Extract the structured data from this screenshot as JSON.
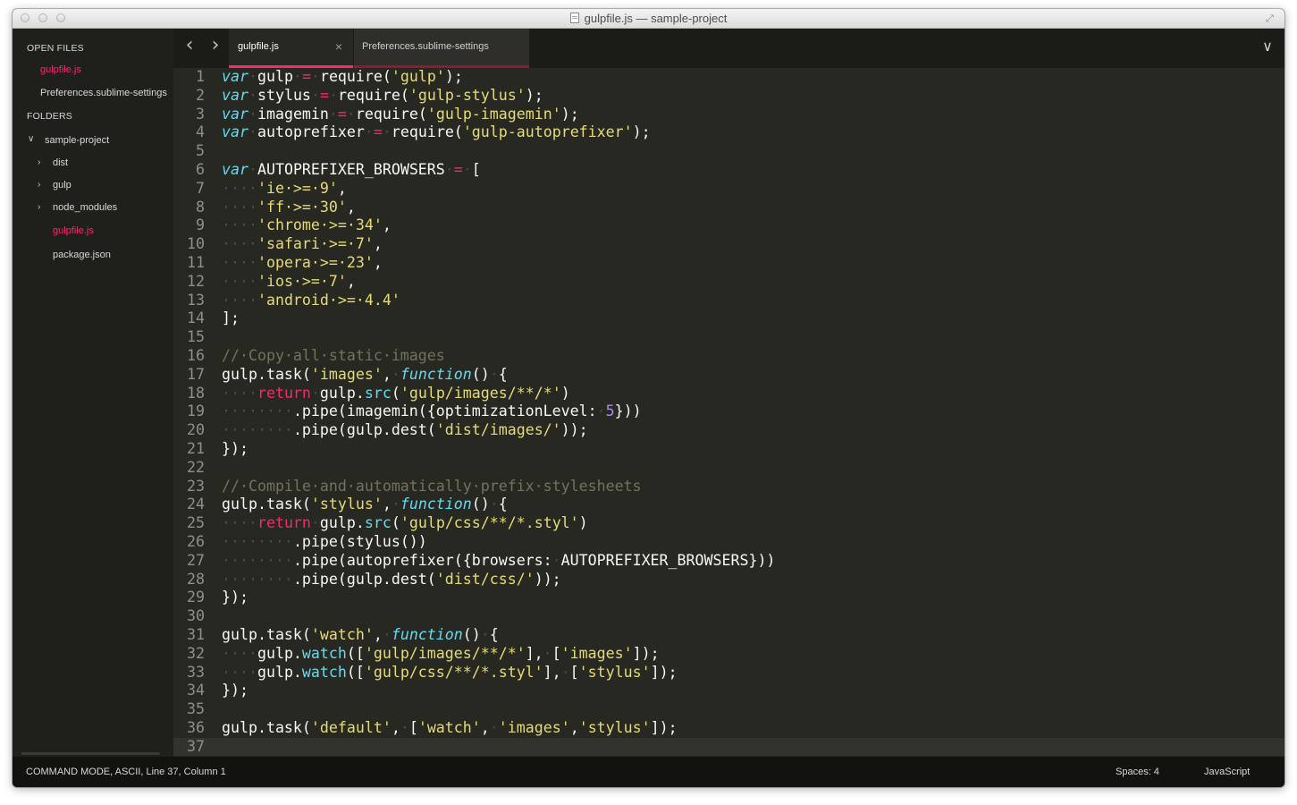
{
  "window": {
    "title": "gulpfile.js — sample-project"
  },
  "sidebar": {
    "open_files_heading": "OPEN FILES",
    "open_files": [
      {
        "label": "gulpfile.js",
        "active": true
      },
      {
        "label": "Preferences.sublime-settings",
        "active": false
      }
    ],
    "folders_heading": "FOLDERS",
    "project": "sample-project",
    "tree": [
      {
        "label": "dist",
        "type": "folder"
      },
      {
        "label": "gulp",
        "type": "folder"
      },
      {
        "label": "node_modules",
        "type": "folder"
      },
      {
        "label": "gulpfile.js",
        "type": "file",
        "active": true
      },
      {
        "label": "package.json",
        "type": "file"
      }
    ]
  },
  "tabs": [
    {
      "label": "gulpfile.js",
      "active": true
    },
    {
      "label": "Preferences.sublime-settings",
      "active": false
    }
  ],
  "editor": {
    "lines": [
      [
        [
          "k-storage",
          "var"
        ],
        [
          "ws",
          "·"
        ],
        [
          "",
          "gulp"
        ],
        [
          "ws",
          "·"
        ],
        [
          "k-op",
          "="
        ],
        [
          "ws",
          "·"
        ],
        [
          "",
          "require("
        ],
        [
          "k-string",
          "'gulp'"
        ],
        [
          "",
          ");"
        ]
      ],
      [
        [
          "k-storage",
          "var"
        ],
        [
          "ws",
          "·"
        ],
        [
          "",
          "stylus"
        ],
        [
          "ws",
          "·"
        ],
        [
          "k-op",
          "="
        ],
        [
          "ws",
          "·"
        ],
        [
          "",
          "require("
        ],
        [
          "k-string",
          "'gulp-stylus'"
        ],
        [
          "",
          ");"
        ]
      ],
      [
        [
          "k-storage",
          "var"
        ],
        [
          "ws",
          "·"
        ],
        [
          "",
          "imagemin"
        ],
        [
          "ws",
          "·"
        ],
        [
          "k-op",
          "="
        ],
        [
          "ws",
          "·"
        ],
        [
          "",
          "require("
        ],
        [
          "k-string",
          "'gulp-imagemin'"
        ],
        [
          "",
          ");"
        ]
      ],
      [
        [
          "k-storage",
          "var"
        ],
        [
          "ws",
          "·"
        ],
        [
          "",
          "autoprefixer"
        ],
        [
          "ws",
          "·"
        ],
        [
          "k-op",
          "="
        ],
        [
          "ws",
          "·"
        ],
        [
          "",
          "require("
        ],
        [
          "k-string",
          "'gulp-autoprefixer'"
        ],
        [
          "",
          ");"
        ]
      ],
      [],
      [
        [
          "k-storage",
          "var"
        ],
        [
          "ws",
          "·"
        ],
        [
          "",
          "AUTOPREFIXER_BROWSERS"
        ],
        [
          "ws",
          "·"
        ],
        [
          "k-op",
          "="
        ],
        [
          "ws",
          "·"
        ],
        [
          "",
          "["
        ]
      ],
      [
        [
          "ws",
          "····"
        ],
        [
          "k-string",
          "'ie·>=·9'"
        ],
        [
          "",
          ","
        ]
      ],
      [
        [
          "ws",
          "····"
        ],
        [
          "k-string",
          "'ff·>=·30'"
        ],
        [
          "",
          ","
        ]
      ],
      [
        [
          "ws",
          "····"
        ],
        [
          "k-string",
          "'chrome·>=·34'"
        ],
        [
          "",
          ","
        ]
      ],
      [
        [
          "ws",
          "····"
        ],
        [
          "k-string",
          "'safari·>=·7'"
        ],
        [
          "",
          ","
        ]
      ],
      [
        [
          "ws",
          "····"
        ],
        [
          "k-string",
          "'opera·>=·23'"
        ],
        [
          "",
          ","
        ]
      ],
      [
        [
          "ws",
          "····"
        ],
        [
          "k-string",
          "'ios·>=·7'"
        ],
        [
          "",
          ","
        ]
      ],
      [
        [
          "ws",
          "····"
        ],
        [
          "k-string",
          "'android·>=·4.4'"
        ]
      ],
      [
        [
          "",
          "];"
        ]
      ],
      [],
      [
        [
          "k-comment",
          "//·Copy·all·static·images"
        ]
      ],
      [
        [
          "",
          "gulp.task("
        ],
        [
          "k-string",
          "'images'"
        ],
        [
          "",
          ","
        ],
        [
          "ws",
          "·"
        ],
        [
          "k-func",
          "function"
        ],
        [
          "",
          "()"
        ],
        [
          "ws",
          "·"
        ],
        [
          "",
          "{"
        ]
      ],
      [
        [
          "ws",
          "····"
        ],
        [
          "k-keyword",
          "return"
        ],
        [
          "ws",
          "·"
        ],
        [
          "",
          "gulp."
        ],
        [
          "k-method",
          "src"
        ],
        [
          "",
          "("
        ],
        [
          "k-string",
          "'gulp/images/**/*'"
        ],
        [
          "",
          ")"
        ]
      ],
      [
        [
          "ws",
          "········"
        ],
        [
          "",
          ".pipe(imagemin({optimizationLevel:"
        ],
        [
          "ws",
          "·"
        ],
        [
          "k-number",
          "5"
        ],
        [
          "",
          "}))"
        ]
      ],
      [
        [
          "ws",
          "········"
        ],
        [
          "",
          ".pipe(gulp.dest("
        ],
        [
          "k-string",
          "'dist/images/'"
        ],
        [
          "",
          "));"
        ]
      ],
      [
        [
          "",
          "});"
        ]
      ],
      [],
      [
        [
          "k-comment",
          "//·Compile·and·automatically·prefix·stylesheets"
        ]
      ],
      [
        [
          "",
          "gulp.task("
        ],
        [
          "k-string",
          "'stylus'"
        ],
        [
          "",
          ","
        ],
        [
          "ws",
          "·"
        ],
        [
          "k-func",
          "function"
        ],
        [
          "",
          "()"
        ],
        [
          "ws",
          "·"
        ],
        [
          "",
          "{"
        ]
      ],
      [
        [
          "ws",
          "····"
        ],
        [
          "k-keyword",
          "return"
        ],
        [
          "ws",
          "·"
        ],
        [
          "",
          "gulp."
        ],
        [
          "k-method",
          "src"
        ],
        [
          "",
          "("
        ],
        [
          "k-string",
          "'gulp/css/**/*.styl'"
        ],
        [
          "",
          ")"
        ]
      ],
      [
        [
          "ws",
          "········"
        ],
        [
          "",
          ".pipe(stylus())"
        ]
      ],
      [
        [
          "ws",
          "········"
        ],
        [
          "",
          ".pipe(autoprefixer({browsers:"
        ],
        [
          "ws",
          "·"
        ],
        [
          "",
          "AUTOPREFIXER_BROWSERS}))"
        ]
      ],
      [
        [
          "ws",
          "········"
        ],
        [
          "",
          ".pipe(gulp.dest("
        ],
        [
          "k-string",
          "'dist/css/'"
        ],
        [
          "",
          "));"
        ]
      ],
      [
        [
          "",
          "});"
        ]
      ],
      [],
      [
        [
          "",
          "gulp.task("
        ],
        [
          "k-string",
          "'watch'"
        ],
        [
          "",
          ","
        ],
        [
          "ws",
          "·"
        ],
        [
          "k-func",
          "function"
        ],
        [
          "",
          "()"
        ],
        [
          "ws",
          "·"
        ],
        [
          "",
          "{"
        ]
      ],
      [
        [
          "ws",
          "····"
        ],
        [
          "",
          "gulp."
        ],
        [
          "k-method",
          "watch"
        ],
        [
          "",
          "(["
        ],
        [
          "k-string",
          "'gulp/images/**/*'"
        ],
        [
          "",
          "],"
        ],
        [
          "ws",
          "·"
        ],
        [
          "",
          "["
        ],
        [
          "k-string",
          "'images'"
        ],
        [
          "",
          "]);"
        ]
      ],
      [
        [
          "ws",
          "····"
        ],
        [
          "",
          "gulp."
        ],
        [
          "k-method",
          "watch"
        ],
        [
          "",
          "(["
        ],
        [
          "k-string",
          "'gulp/css/**/*.styl'"
        ],
        [
          "",
          "],"
        ],
        [
          "ws",
          "·"
        ],
        [
          "",
          "["
        ],
        [
          "k-string",
          "'stylus'"
        ],
        [
          "",
          "]);"
        ]
      ],
      [
        [
          "",
          "});"
        ]
      ],
      [],
      [
        [
          "",
          "gulp.task("
        ],
        [
          "k-string",
          "'default'"
        ],
        [
          "",
          ","
        ],
        [
          "ws",
          "·"
        ],
        [
          "",
          "["
        ],
        [
          "k-string",
          "'watch'"
        ],
        [
          "",
          ","
        ],
        [
          "ws",
          "·"
        ],
        [
          "k-string",
          "'images'"
        ],
        [
          "",
          ","
        ],
        [
          "k-string",
          "'stylus'"
        ],
        [
          "",
          "]);"
        ]
      ],
      []
    ],
    "current_line": 37
  },
  "status": {
    "text": "COMMAND MODE, ASCII, Line 37, Column 1",
    "spaces": "Spaces: 4",
    "syntax": "JavaScript"
  }
}
